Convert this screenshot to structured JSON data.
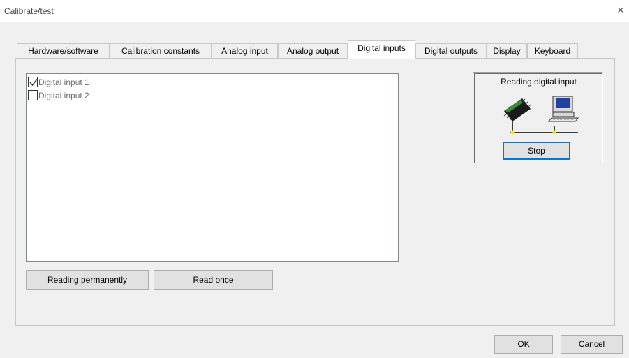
{
  "window": {
    "title": "Calibrate/test",
    "close_glyph": "×"
  },
  "tabs": [
    {
      "label": "Hardware/software",
      "active": false
    },
    {
      "label": "Calibration constants",
      "active": false
    },
    {
      "label": "Analog input",
      "active": false
    },
    {
      "label": "Analog output",
      "active": false
    },
    {
      "label": "Digital inputs",
      "active": true
    },
    {
      "label": "Digital outputs",
      "active": false
    },
    {
      "label": "Display",
      "active": false
    },
    {
      "label": "Keyboard",
      "active": false
    }
  ],
  "digital_inputs": [
    {
      "label": "Digital input 1",
      "checked": true
    },
    {
      "label": "Digital input 2",
      "checked": false
    }
  ],
  "buttons": {
    "reading_permanently": "Reading permanently",
    "read_once": "Read once",
    "stop": "Stop",
    "ok": "OK",
    "cancel": "Cancel"
  },
  "status": {
    "label": "Reading digital input",
    "icons": [
      "chip-icon",
      "computer-icon"
    ]
  },
  "colors": {
    "accent": "#0078d7",
    "connection_dot": "#ffe600"
  }
}
